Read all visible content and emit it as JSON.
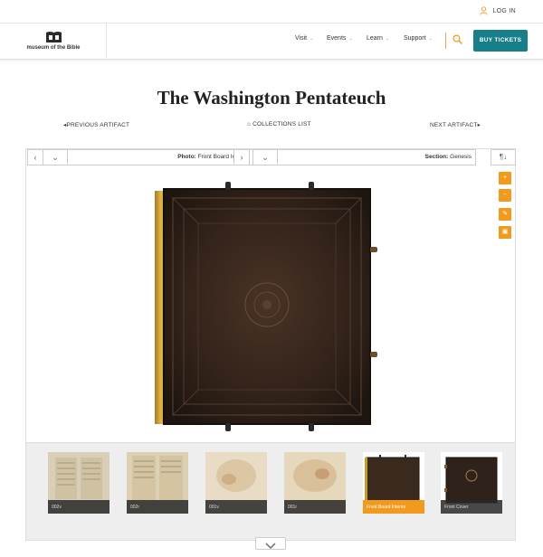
{
  "header": {
    "login_label": "LOG IN",
    "logo_text": "museum of the Bible",
    "nav": [
      {
        "label": "Visit"
      },
      {
        "label": "Events"
      },
      {
        "label": "Learn"
      },
      {
        "label": "Support"
      }
    ],
    "tickets_label": "BUY TICKETS",
    "icons": {
      "login": "user-icon",
      "search": "search-icon",
      "logo": "bible-logo-icon"
    },
    "colors": {
      "accent": "#f29a1e",
      "tickets": "#167f8a"
    }
  },
  "page": {
    "title": "The Washington Pentateuch",
    "prev_label": "PREVIOUS ARTIFACT",
    "collections_label": "COLLECTIONS LIST",
    "next_label": "NEXT ARTIFACT"
  },
  "viewer": {
    "photo_prefix": "Photo:",
    "photo_value": "Front Board Interior",
    "section_prefix": "Section:",
    "section_value": "Genesis",
    "tools": [
      "plus-icon",
      "minus-icon",
      "pencil-icon",
      "clipboard-icon"
    ],
    "thumbnails": [
      {
        "label": "002v",
        "active": false
      },
      {
        "label": "002r",
        "active": false
      },
      {
        "label": "001v",
        "active": false
      },
      {
        "label": "001r",
        "active": false
      },
      {
        "label": "Front Board Interior",
        "active": true
      },
      {
        "label": "Front Cover",
        "active": false
      }
    ]
  }
}
